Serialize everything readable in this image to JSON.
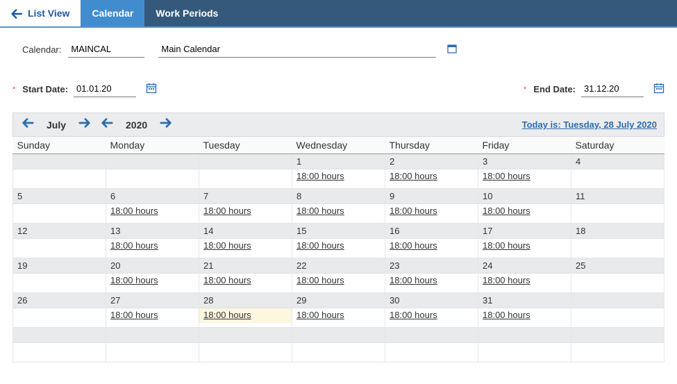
{
  "tabs": {
    "list_view": "List View",
    "calendar": "Calendar",
    "work_periods": "Work Periods"
  },
  "form": {
    "calendar_label": "Calendar:",
    "calendar_code": "MAINCAL",
    "calendar_desc": "Main Calendar",
    "start_label": "Start Date:",
    "start_value": "01.01.20",
    "end_label": "End Date:",
    "end_value": "31.12.20"
  },
  "nav": {
    "month": "July",
    "year": "2020",
    "today_text": "Today is: Tuesday, 28 July 2020"
  },
  "headers": [
    "Sunday",
    "Monday",
    "Tuesday",
    "Wednesday",
    "Thursday",
    "Friday",
    "Saturday"
  ],
  "weeks": [
    [
      {
        "num": "",
        "hours": ""
      },
      {
        "num": "",
        "hours": ""
      },
      {
        "num": "",
        "hours": ""
      },
      {
        "num": "1",
        "hours": "18:00 hours"
      },
      {
        "num": "2",
        "hours": "18:00 hours"
      },
      {
        "num": "3",
        "hours": "18:00 hours"
      },
      {
        "num": "4",
        "hours": ""
      }
    ],
    [
      {
        "num": "5",
        "hours": ""
      },
      {
        "num": "6",
        "hours": "18:00 hours"
      },
      {
        "num": "7",
        "hours": "18:00 hours"
      },
      {
        "num": "8",
        "hours": "18:00 hours"
      },
      {
        "num": "9",
        "hours": "18:00 hours"
      },
      {
        "num": "10",
        "hours": "18:00 hours"
      },
      {
        "num": "11",
        "hours": ""
      }
    ],
    [
      {
        "num": "12",
        "hours": ""
      },
      {
        "num": "13",
        "hours": "18:00 hours"
      },
      {
        "num": "14",
        "hours": "18:00 hours"
      },
      {
        "num": "15",
        "hours": "18:00 hours"
      },
      {
        "num": "16",
        "hours": "18:00 hours"
      },
      {
        "num": "17",
        "hours": "18:00 hours"
      },
      {
        "num": "18",
        "hours": ""
      }
    ],
    [
      {
        "num": "19",
        "hours": ""
      },
      {
        "num": "20",
        "hours": "18:00 hours"
      },
      {
        "num": "21",
        "hours": "18:00 hours"
      },
      {
        "num": "22",
        "hours": "18:00 hours"
      },
      {
        "num": "23",
        "hours": "18:00 hours"
      },
      {
        "num": "24",
        "hours": "18:00 hours"
      },
      {
        "num": "25",
        "hours": ""
      }
    ],
    [
      {
        "num": "26",
        "hours": ""
      },
      {
        "num": "27",
        "hours": "18:00 hours"
      },
      {
        "num": "28",
        "hours": "18:00 hours",
        "today": true
      },
      {
        "num": "29",
        "hours": "18:00 hours"
      },
      {
        "num": "30",
        "hours": "18:00 hours"
      },
      {
        "num": "31",
        "hours": "18:00 hours"
      },
      {
        "num": "",
        "hours": ""
      }
    ],
    [
      {
        "num": "",
        "hours": ""
      },
      {
        "num": "",
        "hours": ""
      },
      {
        "num": "",
        "hours": ""
      },
      {
        "num": "",
        "hours": ""
      },
      {
        "num": "",
        "hours": ""
      },
      {
        "num": "",
        "hours": ""
      },
      {
        "num": "",
        "hours": ""
      }
    ]
  ]
}
